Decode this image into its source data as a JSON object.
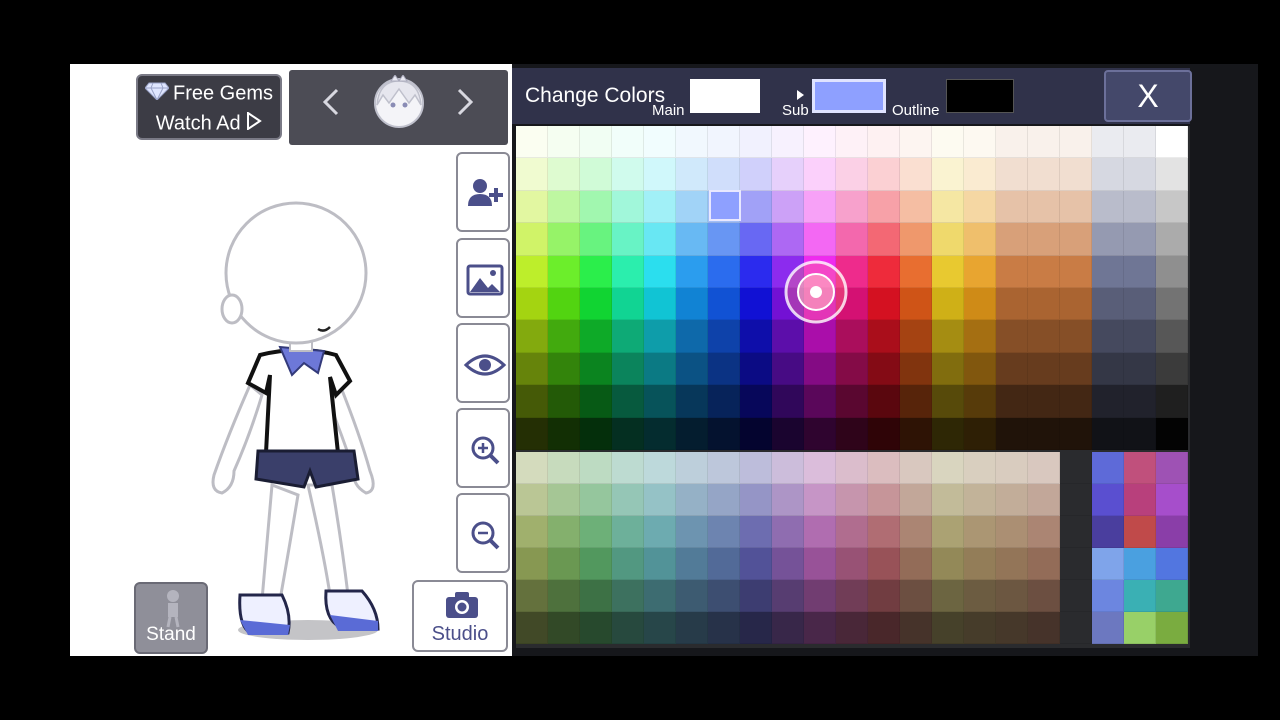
{
  "left_panel": {
    "gems_button": {
      "line1": "Free Gems",
      "line2": "Watch Ad"
    },
    "nav": {
      "prev_icon": "chevron-left-icon",
      "next_icon": "chevron-right-icon",
      "preview": "character-head-preview"
    },
    "side_buttons": [
      {
        "name": "add-character-button",
        "icon": "add-person-icon"
      },
      {
        "name": "background-button",
        "icon": "image-icon"
      },
      {
        "name": "hide-ui-button",
        "icon": "eye-icon"
      },
      {
        "name": "zoom-in-button",
        "icon": "zoom-in-icon"
      },
      {
        "name": "zoom-out-button",
        "icon": "zoom-out-icon"
      }
    ],
    "stand_label": "Stand",
    "studio_label": "Studio"
  },
  "color_panel": {
    "title": "Change Colors",
    "main_label": "Main",
    "sub_label": "Sub",
    "outline_label": "Outline",
    "main_color": "#ffffff",
    "sub_color": "#8ea0ff",
    "outline_color": "#000000",
    "close_label": "X"
  }
}
